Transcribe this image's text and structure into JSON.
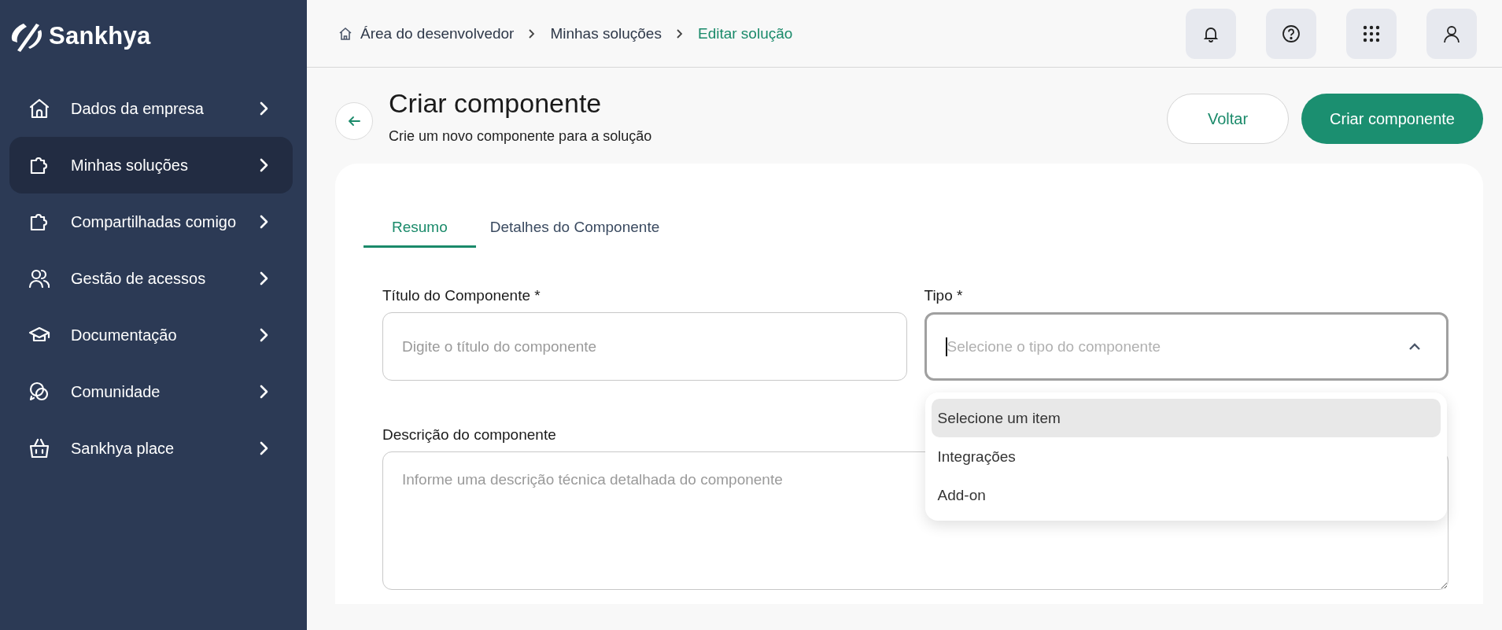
{
  "logo": {
    "text": "Sankhya"
  },
  "sidebar": {
    "items": [
      {
        "label": "Dados da empresa",
        "kind": "house",
        "selected": false
      },
      {
        "label": "Minhas soluções",
        "kind": "puzzle",
        "selected": true
      },
      {
        "label": "Compartilhadas comigo",
        "kind": "puzzle",
        "selected": false
      },
      {
        "label": "Gestão de acessos",
        "kind": "users",
        "selected": false
      },
      {
        "label": "Documentação",
        "kind": "cap",
        "selected": false
      },
      {
        "label": "Comunidade",
        "kind": "chat",
        "selected": false
      },
      {
        "label": "Sankhya place",
        "kind": "basket",
        "selected": false
      }
    ]
  },
  "breadcrumb": [
    {
      "label": "Área do desenvolvedor",
      "current": false
    },
    {
      "label": "Minhas soluções",
      "current": false
    },
    {
      "label": "Editar solução",
      "current": true
    }
  ],
  "page": {
    "title": "Criar componente",
    "subtitle": "Crie um novo componente para a solução",
    "buttons": [
      {
        "label": "Voltar",
        "kind": "secondary"
      },
      {
        "label": "Criar componente",
        "kind": "primary"
      }
    ]
  },
  "tabs": [
    {
      "label": "Resumo",
      "selected": true
    },
    {
      "label": "Detalhes do Componente",
      "selected": false
    }
  ],
  "form": {
    "title_field": {
      "label": "Título do Componente *",
      "placeholder": "Digite o título do componente"
    },
    "type_field": {
      "label": "Tipo *",
      "placeholder": "Selecione o tipo do componente",
      "expanded": true,
      "options": [
        {
          "label": "Selecione um item",
          "selected": true
        },
        {
          "label": "Integrações",
          "selected": false
        },
        {
          "label": "Add-on",
          "selected": false
        }
      ]
    },
    "description_field": {
      "label": "Descrição do componente",
      "placeholder": "Informe uma descrição técnica detalhada do componente"
    }
  }
}
